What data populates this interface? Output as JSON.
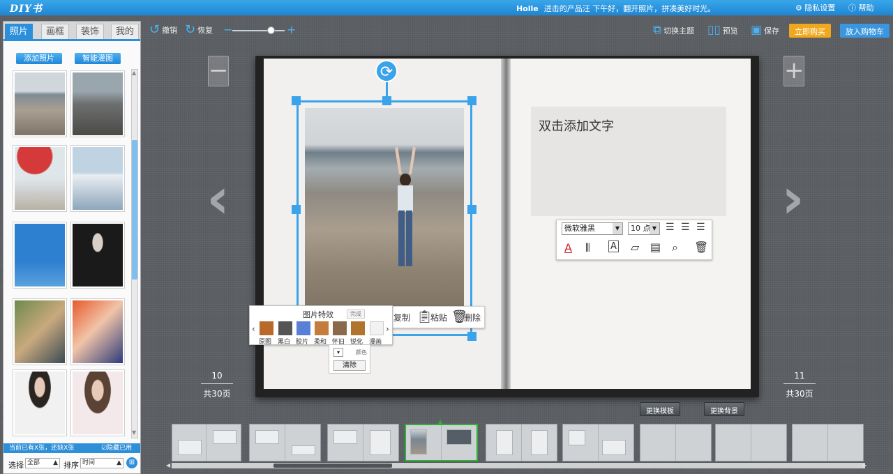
{
  "app": {
    "logo": "DIY书",
    "greeting_user": "Holle",
    "greeting_text": "进击的产品汪  下午好，翻开照片，拼凑美好时光。",
    "privacy_label": "隐私设置",
    "help_label": "帮助"
  },
  "toolbar": {
    "undo_label": "撤销",
    "redo_label": "恢复",
    "zoom_level": 0.75,
    "switch_theme_label": "切换主题",
    "preview_label": "预览",
    "save_label": "保存",
    "buy_now_label": "立即购买",
    "add_cart_label": "放入购物车"
  },
  "panel": {
    "tabs": [
      {
        "label": "照片",
        "active": true
      },
      {
        "label": "画框",
        "active": false
      },
      {
        "label": "装饰",
        "active": false
      },
      {
        "label": "我的",
        "active": false
      }
    ],
    "add_photo_label": "添加照片",
    "smart_fill_label": "智能灌图",
    "status_text": "当前已有X张，还缺X张",
    "hide_used_label": "隐藏已用",
    "hide_used_checked": true,
    "select_label": "选择",
    "select_value": "全部",
    "sort_label": "排序",
    "sort_value": "时间"
  },
  "editor": {
    "effects_title": "图片特效",
    "effects_done": "完成",
    "effects": [
      "原图",
      "黑白",
      "胶片",
      "柔和",
      "怀旧",
      "锐化",
      "漫画"
    ],
    "color_label": "颜色",
    "clear_label": "清除",
    "copy_label": "复制",
    "paste_label": "粘贴",
    "delete_label": "删除",
    "text_placeholder": "双击添加文字",
    "font_value": "微软雅黑",
    "size_value": "10 点"
  },
  "pages": {
    "left_page": "10",
    "left_total": "共30页",
    "right_page": "11",
    "right_total": "共30页"
  },
  "bottom": {
    "change_template_label": "更换模板",
    "change_bg_label": "更换背景"
  },
  "colors": {
    "accent": "#2b8fdc",
    "buy_now": "#f0a81e",
    "selection": "#3aa3ea"
  }
}
